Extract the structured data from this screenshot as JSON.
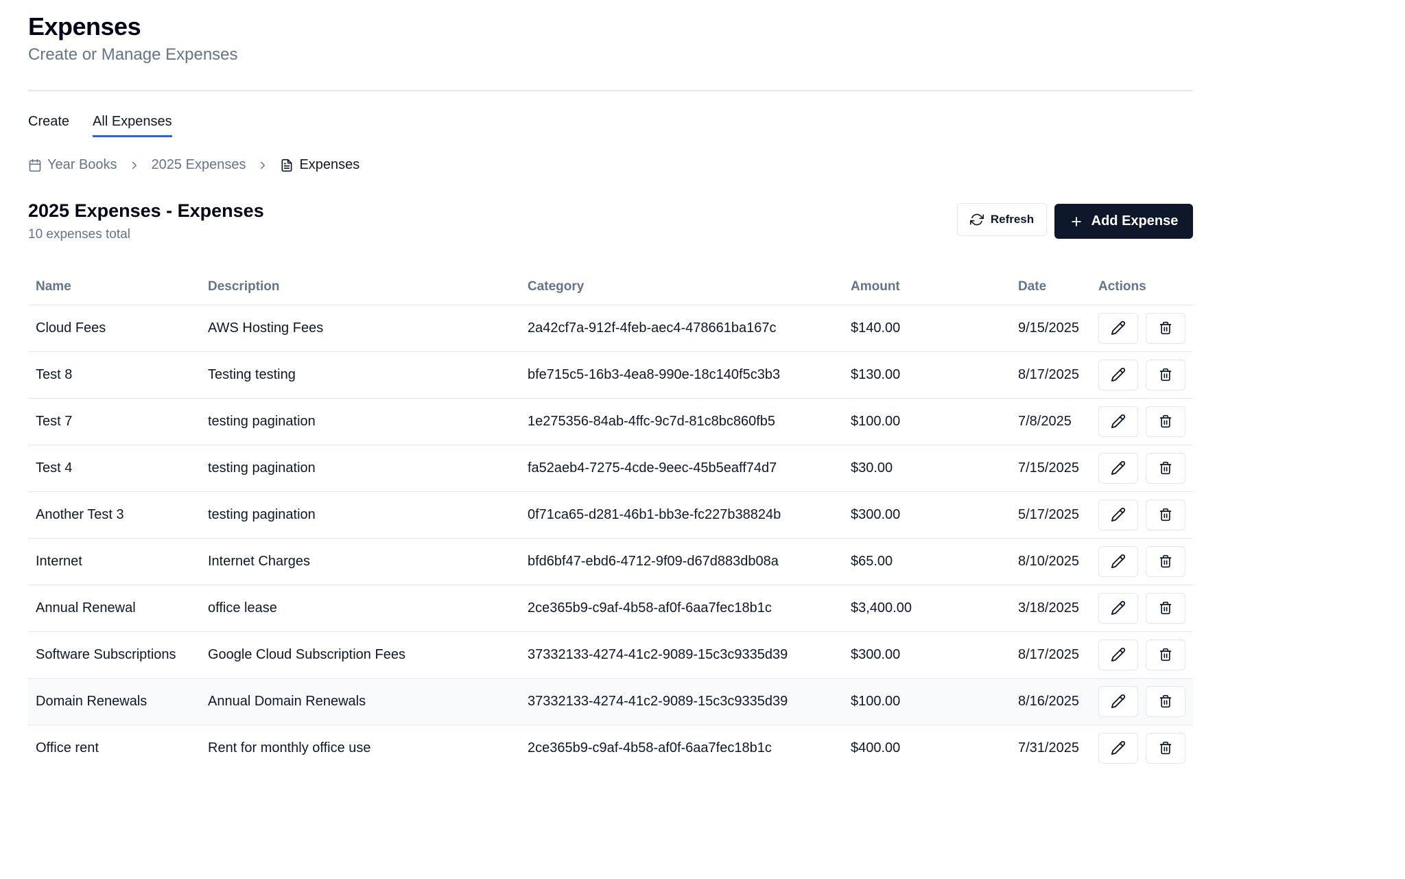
{
  "header": {
    "title": "Expenses",
    "subtitle": "Create or Manage Expenses"
  },
  "tabs": [
    {
      "label": "Create",
      "active": false
    },
    {
      "label": "All Expenses",
      "active": true
    }
  ],
  "breadcrumb": [
    {
      "label": "Year Books",
      "icon": "calendar-icon"
    },
    {
      "label": "2025 Expenses"
    },
    {
      "label": "Expenses",
      "icon": "document-icon"
    }
  ],
  "section": {
    "title": "2025 Expenses - Expenses",
    "count_text": "10 expenses total",
    "refresh_label": "Refresh",
    "add_label": "Add Expense"
  },
  "table": {
    "headers": [
      "Name",
      "Description",
      "Category",
      "Amount",
      "Date",
      "Actions"
    ],
    "rows": [
      {
        "name": "Cloud Fees",
        "description": "AWS Hosting Fees",
        "category": "2a42cf7a-912f-4feb-aec4-478661ba167c",
        "amount": "$140.00",
        "date": "9/15/2025"
      },
      {
        "name": "Test 8",
        "description": "Testing testing",
        "category": "bfe715c5-16b3-4ea8-990e-18c140f5c3b3",
        "amount": "$130.00",
        "date": "8/17/2025"
      },
      {
        "name": "Test 7",
        "description": "testing pagination",
        "category": "1e275356-84ab-4ffc-9c7d-81c8bc860fb5",
        "amount": "$100.00",
        "date": "7/8/2025"
      },
      {
        "name": "Test 4",
        "description": "testing pagination",
        "category": "fa52aeb4-7275-4cde-9eec-45b5eaff74d7",
        "amount": "$30.00",
        "date": "7/15/2025"
      },
      {
        "name": "Another Test 3",
        "description": "testing pagination",
        "category": "0f71ca65-d281-46b1-bb3e-fc227b38824b",
        "amount": "$300.00",
        "date": "5/17/2025"
      },
      {
        "name": "Internet",
        "description": "Internet Charges",
        "category": "bfd6bf47-ebd6-4712-9f09-d67d883db08a",
        "amount": "$65.00",
        "date": "8/10/2025"
      },
      {
        "name": "Annual Renewal",
        "description": "office lease",
        "category": "2ce365b9-c9af-4b58-af0f-6aa7fec18b1c",
        "amount": "$3,400.00",
        "date": "3/18/2025"
      },
      {
        "name": "Software Subscriptions",
        "description": "Google Cloud Subscription Fees",
        "category": "37332133-4274-41c2-9089-15c3c9335d39",
        "amount": "$300.00",
        "date": "8/17/2025"
      },
      {
        "name": "Domain Renewals",
        "description": "Annual Domain Renewals",
        "category": "37332133-4274-41c2-9089-15c3c9335d39",
        "amount": "$100.00",
        "date": "8/16/2025",
        "highlighted": true
      },
      {
        "name": "Office rent",
        "description": "Rent for monthly office use",
        "category": "2ce365b9-c9af-4b58-af0f-6aa7fec18b1c",
        "amount": "$400.00",
        "date": "7/31/2025"
      }
    ],
    "row_actions": [
      "pencil-icon",
      "trash-icon"
    ]
  },
  "colors": {
    "primary": "#0f172a",
    "muted": "#64748b",
    "tab_underline": "#2563eb",
    "border": "#e5e7eb"
  }
}
